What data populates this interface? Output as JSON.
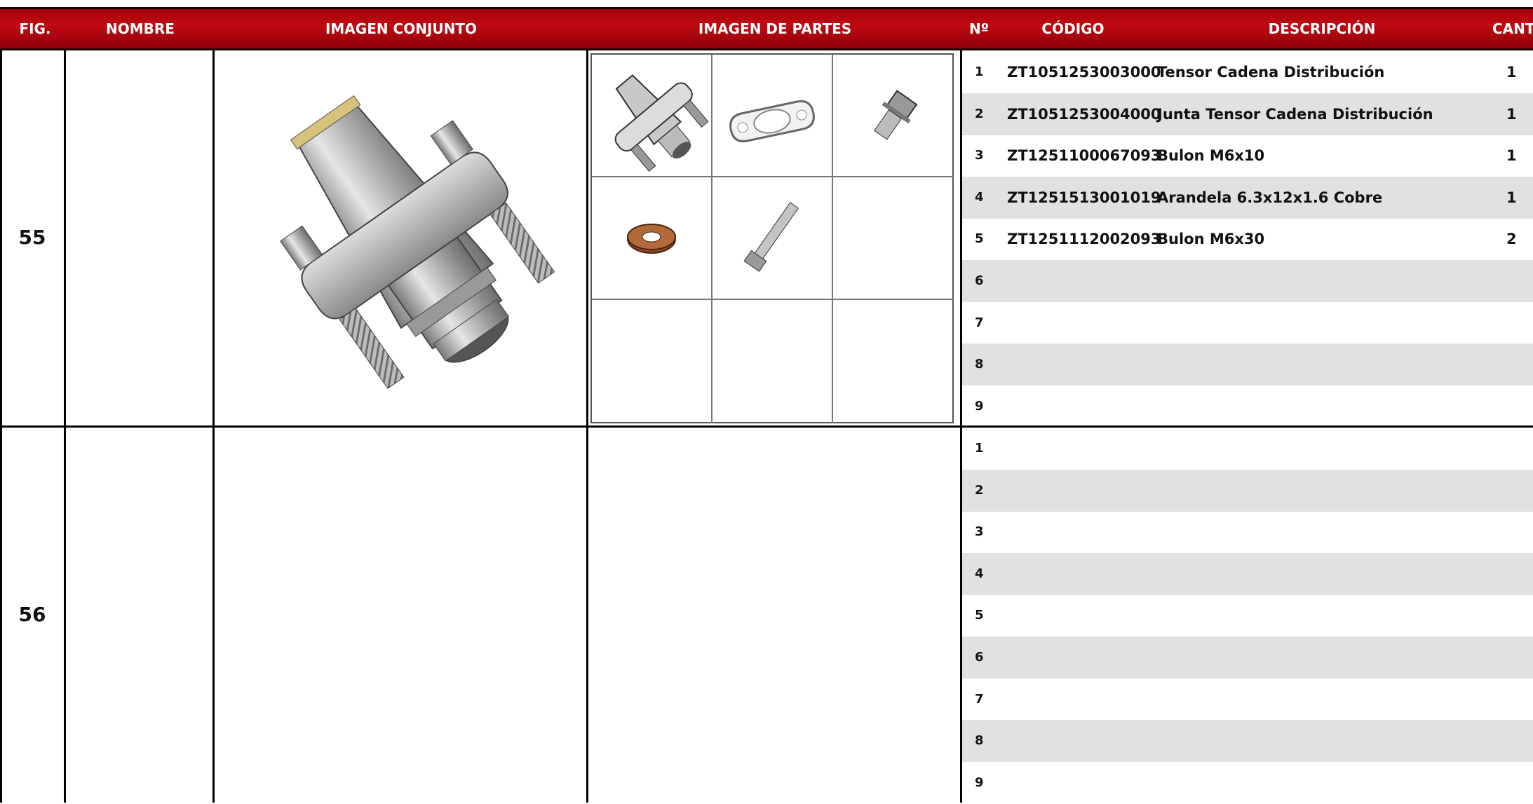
{
  "header": {
    "fig": "FIG.",
    "nombre": "NOMBRE",
    "imagen_conjunto": "IMAGEN CONJUNTO",
    "imagen_partes": "IMAGEN DE PARTES",
    "numero": "Nº",
    "codigo": "CÓDIGO",
    "descripcion": "DESCRIPCIÓN",
    "cantidad": "CANT."
  },
  "colors": {
    "header_bg": "#b0040c",
    "row_shade": "#e1e1e1"
  },
  "groups": [
    {
      "fig": "55",
      "nombre": "",
      "rows": [
        {
          "n": "1",
          "codigo": "ZT1051253003000",
          "descripcion": "Tensor Cadena Distribución",
          "cant": "1"
        },
        {
          "n": "2",
          "codigo": "ZT1051253004000",
          "descripcion": "Junta Tensor Cadena Distribución",
          "cant": "1"
        },
        {
          "n": "3",
          "codigo": "ZT1251100067093",
          "descripcion": "Bulon M6x10",
          "cant": "1"
        },
        {
          "n": "4",
          "codigo": "ZT1251513001019",
          "descripcion": "Arandela 6.3x12x1.6 Cobre",
          "cant": "1"
        },
        {
          "n": "5",
          "codigo": "ZT1251112002093",
          "descripcion": "Bulon M6x30",
          "cant": "2"
        },
        {
          "n": "6",
          "codigo": "",
          "descripcion": "",
          "cant": ""
        },
        {
          "n": "7",
          "codigo": "",
          "descripcion": "",
          "cant": ""
        },
        {
          "n": "8",
          "codigo": "",
          "descripcion": "",
          "cant": ""
        },
        {
          "n": "9",
          "codigo": "",
          "descripcion": "",
          "cant": ""
        }
      ],
      "part_images": [
        "tensor-icon",
        "gasket-icon",
        "bolt-short-icon",
        "copper-washer-icon",
        "bolt-long-icon",
        "",
        "",
        "",
        ""
      ]
    },
    {
      "fig": "56",
      "nombre": "",
      "rows": [
        {
          "n": "1",
          "codigo": "",
          "descripcion": "",
          "cant": ""
        },
        {
          "n": "2",
          "codigo": "",
          "descripcion": "",
          "cant": ""
        },
        {
          "n": "3",
          "codigo": "",
          "descripcion": "",
          "cant": ""
        },
        {
          "n": "4",
          "codigo": "",
          "descripcion": "",
          "cant": ""
        },
        {
          "n": "5",
          "codigo": "",
          "descripcion": "",
          "cant": ""
        },
        {
          "n": "6",
          "codigo": "",
          "descripcion": "",
          "cant": ""
        },
        {
          "n": "7",
          "codigo": "",
          "descripcion": "",
          "cant": ""
        },
        {
          "n": "8",
          "codigo": "",
          "descripcion": "",
          "cant": ""
        },
        {
          "n": "9",
          "codigo": "",
          "descripcion": "",
          "cant": ""
        }
      ]
    }
  ]
}
